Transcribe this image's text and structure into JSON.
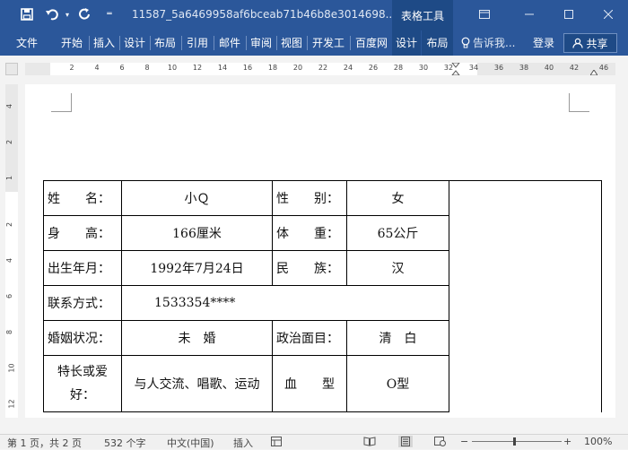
{
  "titlebar": {
    "save_icon": "save-icon",
    "undo_icon": "undo-icon",
    "redo_icon": "redo-icon",
    "customize_icon": "chevron-down-icon",
    "doc_title": "11587_5a6469958af6bceab71b46b8e3014698....",
    "context_group": "表格工具",
    "ribbon_display_icon": "ribbon-display-icon",
    "minimize_icon": "minimize-icon",
    "maximize_icon": "maximize-icon",
    "close_icon": "close-icon"
  },
  "ribbon": {
    "tabs": [
      "文件",
      "开始",
      "插入",
      "设计",
      "布局",
      "引用",
      "邮件",
      "审阅",
      "视图",
      "开发工",
      "百度网",
      "设计",
      "布局"
    ],
    "tell_me": "告诉我...",
    "login": "登录",
    "share": "共享"
  },
  "ruler": {
    "numbers": [
      "2",
      "4",
      "6",
      "8",
      "10",
      "12",
      "14",
      "16",
      "18",
      "20",
      "22",
      "24",
      "26",
      "28",
      "30",
      "32",
      "34",
      "36",
      "38",
      "40",
      "42",
      "46"
    ],
    "vertical_numbers": [
      "4",
      "2",
      "1",
      "2",
      "4",
      "6",
      "8",
      "10",
      "12"
    ]
  },
  "table": {
    "rows": [
      [
        {
          "text": "姓　　名：",
          "kind": "lbl"
        },
        {
          "text": "小Ｑ",
          "kind": "val"
        },
        {
          "text": "性　　别：",
          "kind": "lbl"
        },
        {
          "text": "女",
          "kind": "val"
        }
      ],
      [
        {
          "text": "身　　高：",
          "kind": "lbl"
        },
        {
          "text": "166厘米",
          "kind": "val"
        },
        {
          "text": "体　　重：",
          "kind": "lbl"
        },
        {
          "text": "65公斤",
          "kind": "val"
        }
      ],
      [
        {
          "text": "出生年月：",
          "kind": "lbl"
        },
        {
          "text": "1992年7月24日",
          "kind": "val"
        },
        {
          "text": "民　　族：",
          "kind": "lbl"
        },
        {
          "text": "汉",
          "kind": "val"
        }
      ],
      [
        {
          "text": "联系方式：",
          "kind": "lbl"
        },
        {
          "text": "1533354****",
          "kind": "wide"
        }
      ],
      [
        {
          "text": "婚姻状况：",
          "kind": "lbl"
        },
        {
          "text": "未　婚",
          "kind": "val"
        },
        {
          "text": "政治面目：",
          "kind": "lbl"
        },
        {
          "text": "清　白",
          "kind": "val"
        }
      ],
      [
        {
          "text": "特长或爱好：",
          "kind": "lblc"
        },
        {
          "text": "与人交流、唱歌、运动",
          "kind": "val"
        },
        {
          "text": "血　　型",
          "kind": "val"
        },
        {
          "text": "O型",
          "kind": "val"
        }
      ]
    ]
  },
  "status": {
    "page": "第 1 页，共 2 页",
    "words": "532 个字",
    "lang": "中文(中国)",
    "mode": "插入",
    "zoom": "100%",
    "zoom_minus": "−",
    "zoom_plus": "+",
    "macro_icon": "macro-record-icon",
    "read_mode_icon": "read-mode-icon",
    "print_layout_icon": "print-layout-icon",
    "web_layout_icon": "web-layout-icon"
  }
}
